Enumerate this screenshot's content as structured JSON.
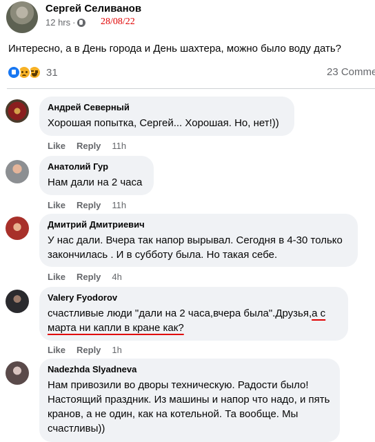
{
  "post": {
    "author": "Сергей Селиванов",
    "time": "12 hrs",
    "separator": "·",
    "date_stamp": "28/08/22",
    "text": "Интересно, а в День города и День шахтера, можно было воду дать?",
    "reaction_count": "31",
    "comments_count": "23 Comme",
    "reactions": [
      "like",
      "sad",
      "haha"
    ],
    "colors": {
      "like": "#1877f2",
      "emoji": "#f7b125",
      "stamp": "#e00000"
    }
  },
  "actions": {
    "like": "Like",
    "reply": "Reply"
  },
  "comments": [
    {
      "name": "Андрей Северный",
      "text": "Хорошая попытка, Сергей... Хорошая. Но, нет!))",
      "time": "11h"
    },
    {
      "name": "Анатолий Гур",
      "text": "Нам дали на 2 часа",
      "time": "11h"
    },
    {
      "name": "Дмитрий Дмитриевич",
      "text_line1": "У нас дали. Вчера так напор вырывал. Сегодня в 4-30 только",
      "text_line2": "закончилась . И в субботу была. Но такая себе.",
      "time": "4h"
    },
    {
      "name": "Valery Fyodorov",
      "text_line1_a": "счастливые люди \"дали на 2 часа,вчера была\".Друзья,",
      "text_line1_b": "а с",
      "text_line2": "марта ни капли в кране как?",
      "time": "1h"
    },
    {
      "name": "Nadezhda Slyadneva",
      "text_line1": "Нам привозили во дворы техническую. Радости было!",
      "text_line2": "Настоящий праздник. Из машины и напор что надо, и пять",
      "text_line3": "кранов, а не один, как на котельной. Та вообще. Мы",
      "text_line4": "счастливы))"
    }
  ]
}
